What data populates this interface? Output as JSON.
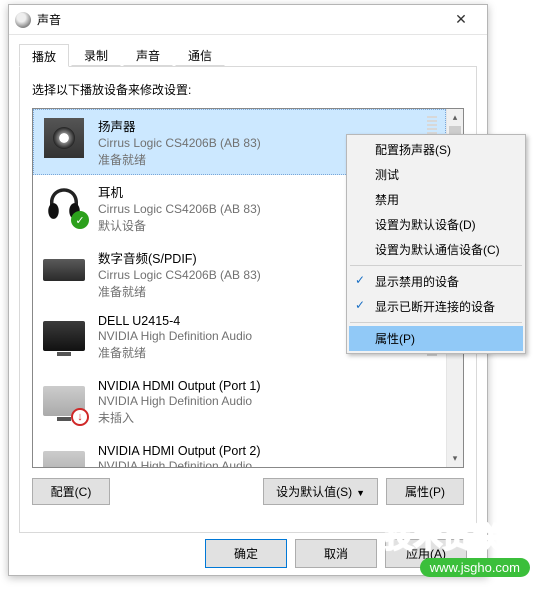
{
  "window": {
    "title": "声音"
  },
  "tabs": [
    "播放",
    "录制",
    "声音",
    "通信"
  ],
  "hint": "选择以下播放设备来修改设置:",
  "devices": [
    {
      "name": "扬声器",
      "sub": "Cirrus Logic CS4206B (AB 83)",
      "status": "准备就绪"
    },
    {
      "name": "耳机",
      "sub": "Cirrus Logic CS4206B (AB 83)",
      "status": "默认设备"
    },
    {
      "name": "数字音频(S/PDIF)",
      "sub": "Cirrus Logic CS4206B (AB 83)",
      "status": "准备就绪"
    },
    {
      "name": "DELL U2415-4",
      "sub": "NVIDIA High Definition Audio",
      "status": "准备就绪"
    },
    {
      "name": "NVIDIA HDMI Output (Port 1)",
      "sub": "NVIDIA High Definition Audio",
      "status": "未插入"
    },
    {
      "name": "NVIDIA HDMI Output (Port 2)",
      "sub": "NVIDIA High Definition Audio",
      "status": ""
    }
  ],
  "panelButtons": {
    "configure": "配置(C)",
    "default": "设为默认值(S)",
    "properties": "属性(P)"
  },
  "dlgButtons": {
    "ok": "确定",
    "cancel": "取消",
    "apply": "应用(A)"
  },
  "menu": {
    "items": [
      "配置扬声器(S)",
      "测试",
      "禁用",
      "设置为默认设备(D)",
      "设置为默认通信设备(C)",
      "显示禁用的设备",
      "显示已断开连接的设备",
      "属性(P)"
    ]
  },
  "watermark": {
    "brand": "技术员联盟",
    "url": "www.jsgho.com"
  }
}
